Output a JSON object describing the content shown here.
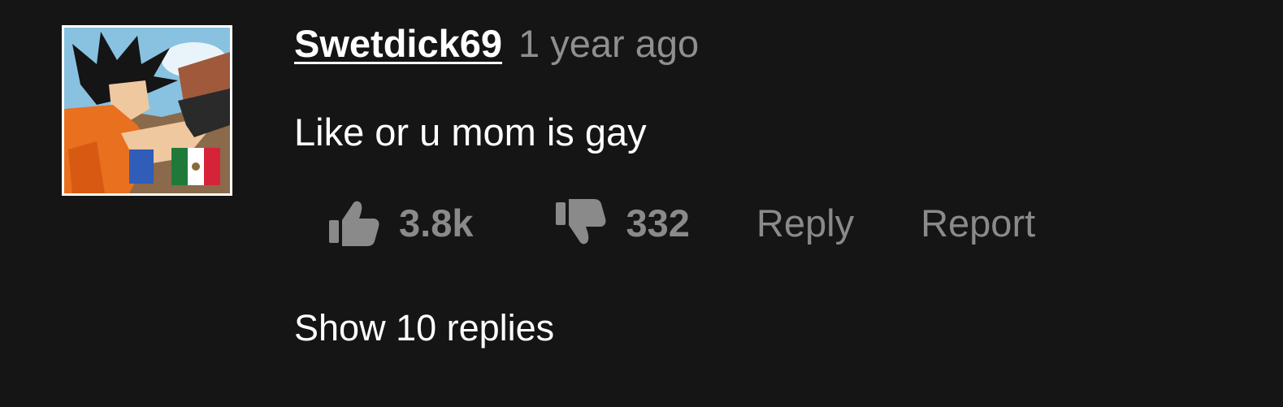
{
  "comment": {
    "avatar": {
      "icon": "goku-avatar-with-mexico-flag",
      "alt": ""
    },
    "username": "Swetdick69",
    "timestamp": "1 year ago",
    "text": "Like or u mom is gay",
    "likes": {
      "icon": "thumbs-up-icon",
      "count": "3.8k"
    },
    "dislikes": {
      "icon": "thumbs-down-icon",
      "count": "332"
    },
    "reply_label": "Reply",
    "report_label": "Report",
    "show_replies_label": "Show 10 replies"
  },
  "colors": {
    "background": "#151515",
    "primary_text": "#ffffff",
    "muted_text": "#8a8a8a",
    "avatar_border": "#ffffff"
  }
}
